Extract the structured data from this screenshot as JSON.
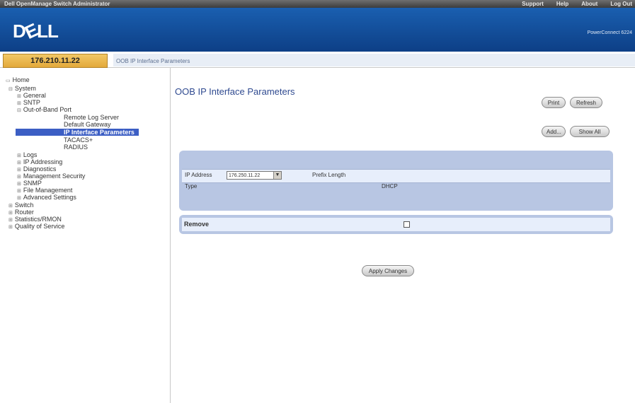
{
  "header": {
    "app_title": "Dell OpenManage Switch Administrator",
    "links": [
      "Support",
      "Help",
      "About",
      "Log Out"
    ],
    "brand_logo": "D",
    "brand_logo_e": "E",
    "brand_logo_rest": "LL",
    "product_label": "PowerConnect 6224"
  },
  "address_bar": {
    "ip": "176.210.11.22",
    "page_crumb": "OOB IP Interface Parameters"
  },
  "sidebar": {
    "items": [
      {
        "label": "Home",
        "ex": ""
      },
      {
        "label": "System",
        "ex": "⊟"
      },
      {
        "label": "General",
        "ex": "⊞"
      },
      {
        "label": "SNTP",
        "ex": "⊞"
      },
      {
        "label": "Out-of-Band Port",
        "ex": "⊟"
      },
      {
        "label": "Remote Log Server",
        "ex": ""
      },
      {
        "label": "Default Gateway",
        "ex": ""
      },
      {
        "label": "IP Interface Parameters",
        "ex": ""
      },
      {
        "label": "TACACS+",
        "ex": ""
      },
      {
        "label": "RADIUS",
        "ex": ""
      },
      {
        "label": "Logs",
        "ex": "⊞"
      },
      {
        "label": "IP Addressing",
        "ex": "⊞"
      },
      {
        "label": "Diagnostics",
        "ex": "⊞"
      },
      {
        "label": "Management Security",
        "ex": "⊞"
      },
      {
        "label": "SNMP",
        "ex": "⊞"
      },
      {
        "label": "File Management",
        "ex": "⊞"
      },
      {
        "label": "Advanced Settings",
        "ex": "⊞"
      },
      {
        "label": "Switch",
        "ex": "⊞"
      },
      {
        "label": "Router",
        "ex": "⊞"
      },
      {
        "label": "Statistics/RMON",
        "ex": "⊞"
      },
      {
        "label": "Quality of Service",
        "ex": "⊞"
      }
    ]
  },
  "main": {
    "title": "OOB IP Interface Parameters",
    "buttons": {
      "print": "Print",
      "refresh": "Refresh",
      "add": "Add...",
      "show_all": "Show All",
      "apply": "Apply Changes"
    },
    "form": {
      "ip_address_label": "IP Address",
      "ip_address_value": "176.250.11.22",
      "prefix_length_label": "Prefix Length",
      "type_label": "Type",
      "type_value": "DHCP",
      "remove_label": "Remove"
    }
  },
  "colors": {
    "brand_blue": "#1a5fb0",
    "panel_blue": "#b8c6e3",
    "selected_item": "#3c5ec4",
    "ip_cell": "#e3a93a"
  }
}
